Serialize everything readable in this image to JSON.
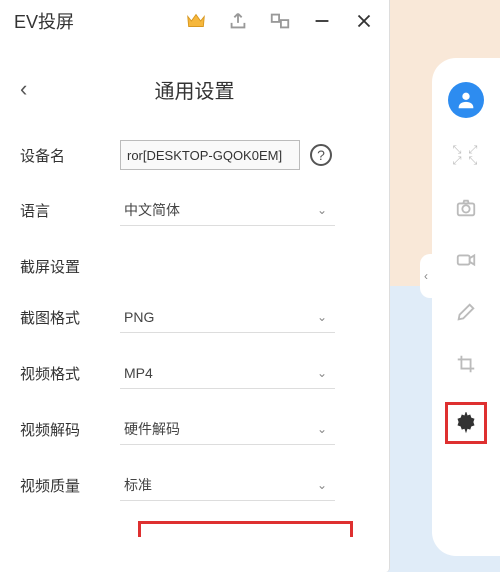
{
  "titlebar": {
    "app_name": "EV投屏"
  },
  "page": {
    "title": "通用设置"
  },
  "device": {
    "label": "设备名",
    "value": "ror[DESKTOP-GQOK0EM]"
  },
  "language": {
    "label": "语言",
    "value": "中文简体"
  },
  "screenshot_section": "截屏设置",
  "screenshot_format": {
    "label": "截图格式",
    "value": "PNG"
  },
  "video_format": {
    "label": "视频格式",
    "value": "MP4"
  },
  "video_decode": {
    "label": "视频解码",
    "value": "硬件解码"
  },
  "video_quality": {
    "label": "视频质量",
    "value": "标准"
  }
}
